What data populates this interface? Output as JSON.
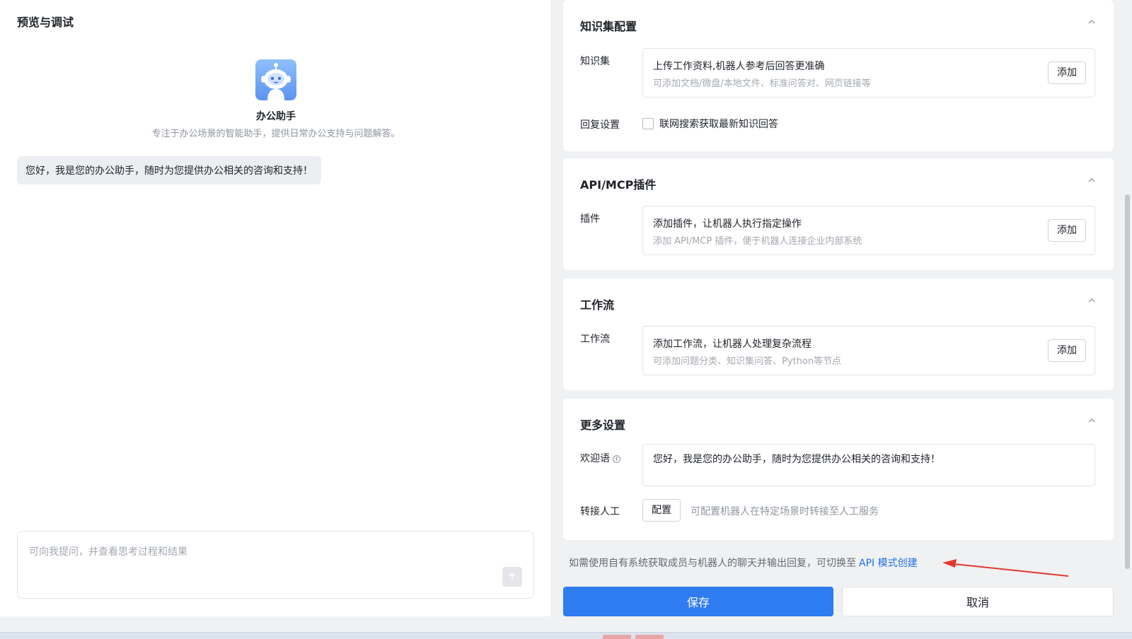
{
  "preview": {
    "title": "预览与调试",
    "bot_name": "办公助手",
    "bot_desc": "专注于办公场景的智能助手，提供日常办公支持与问题解答。",
    "greeting": "您好，我是您的办公助手，随时为您提供办公相关的咨询和支持！",
    "input_placeholder": "可向我提问，并查看思考过程和结果"
  },
  "knowledge": {
    "title": "知识集配置",
    "label": "知识集",
    "main": "上传工作资料,机器人参考后回答更准确",
    "sub": "可添加文档/微盘/本地文件、标准问答对、网页链接等",
    "add": "添加",
    "reply_label": "回复设置",
    "web_search_label": "联网搜索获取最新知识回答"
  },
  "plugin": {
    "title": "API/MCP插件",
    "label": "插件",
    "main": "添加插件，让机器人执行指定操作",
    "sub": "添加 API/MCP 插件，便于机器人连接企业内部系统",
    "add": "添加"
  },
  "workflow": {
    "title": "工作流",
    "label": "工作流",
    "main": "添加工作流，让机器人处理复杂流程",
    "sub": "可添加问题分类、知识集问答、Python等节点",
    "add": "添加"
  },
  "more": {
    "title": "更多设置",
    "welcome_label": "欢迎语",
    "welcome_text": "您好，我是您的办公助手，随时为您提供办公相关的咨询和支持！",
    "transfer_label": "转接人工",
    "config": "配置",
    "transfer_hint": "可配置机器人在特定场景时转接至人工服务"
  },
  "footer": {
    "api_hint": "如需使用自有系统获取成员与机器人的聊天并输出回复，可切换至",
    "api_link": "API 模式创建",
    "save": "保存",
    "cancel": "取消"
  },
  "colors": {
    "primary": "#2f7bf0",
    "link": "#1e6fe8",
    "annotation_arrow": "#e03a2f"
  }
}
